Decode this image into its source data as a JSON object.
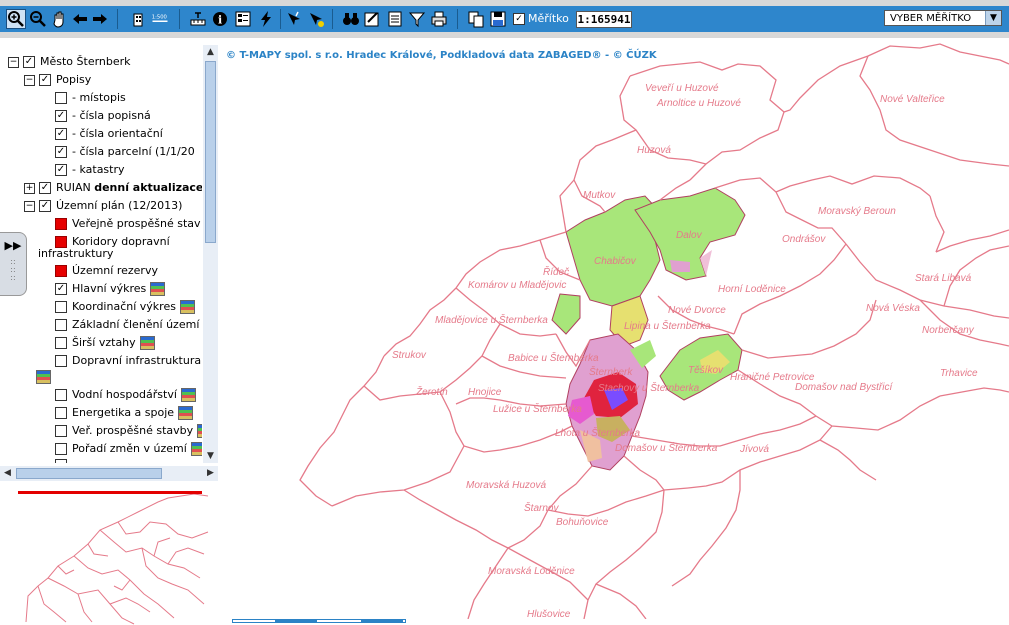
{
  "toolbar": {
    "buttons": [
      {
        "name": "zoom-in-icon"
      },
      {
        "name": "zoom-out-icon"
      },
      {
        "name": "pan-hand-icon"
      },
      {
        "name": "back-arrow-icon"
      },
      {
        "name": "forward-arrow-icon"
      },
      {
        "name": "scale-1-500-icon"
      },
      {
        "name": "measure-icon"
      },
      {
        "name": "info-icon"
      },
      {
        "name": "legend-icon"
      },
      {
        "name": "lightning-icon"
      },
      {
        "name": "identify-icon"
      },
      {
        "name": "highlight-icon"
      },
      {
        "name": "binoculars-icon"
      },
      {
        "name": "edit-icon"
      },
      {
        "name": "document-icon"
      },
      {
        "name": "filter-icon"
      },
      {
        "name": "print-icon"
      },
      {
        "name": "export-icon"
      },
      {
        "name": "save-icon"
      }
    ],
    "scale_label": "Měřítko",
    "scale_value": "1:165941",
    "scale_select": "VYBER MĚŘÍTKO"
  },
  "tree": {
    "root": "Město Šternberk",
    "popisy": "Popisy",
    "items_popisy": [
      "- místopis",
      "- čísla popisná",
      "- čísla orientační",
      "- čísla parcelní (1/1/20",
      "- katastry"
    ],
    "ruian_prefix": "RUIAN ",
    "ruian_bold": "denní aktualizace",
    "uzemni_plan": "Územní plán (12/2013)",
    "layers": [
      "Veřejně prospěšné stav",
      "Koridory dopravní",
      "infrastruktury",
      "Územní rezervy",
      "Hlavní výkres",
      "Koordinační výkres",
      "Základní členění území",
      "Širší vztahy",
      "Dopravní infrastruktura",
      "Vodní hospodářství",
      "Energetika a spoje",
      "Veř. prospěšné stavby",
      "Pořadí změn v území"
    ]
  },
  "map": {
    "copyright": "© T-MAPY spol. s r.o. Hradec Králové, Podkladová data ZABAGED® - © ČÚZK",
    "labels": [
      "Veveří u Huzové",
      "Arnoltice u Huzové",
      "Nové Valteřice",
      "Huzová",
      "Mutkov",
      "Moravský Beroun",
      "Dalov",
      "Ondrášov",
      "Chabičov",
      "Řídeč",
      "Horní Loděnice",
      "Stará Libavá",
      "Komárov u Mladějovic",
      "Nové Dvorce",
      "Nová Véska",
      "Mladějovice u Šternberka",
      "Lipina u Šternberka",
      "Norberčany",
      "Babice u Šternberka",
      "Těšíkov",
      "Strukov",
      "Šternberk",
      "Hraničné Petrovice",
      "Trhavice",
      "Žerotín",
      "Hnojice",
      "Stachovy u Šternberka",
      "Domašov nad Bystřicí",
      "Lužice u Šternberka",
      "Lhota u Šternberka",
      "Domašov u Šternberka",
      "Jívová",
      "Moravská Huzová",
      "Štarnov",
      "Bohuňovice",
      "Moravská Loděnice",
      "Hlušovice"
    ]
  }
}
